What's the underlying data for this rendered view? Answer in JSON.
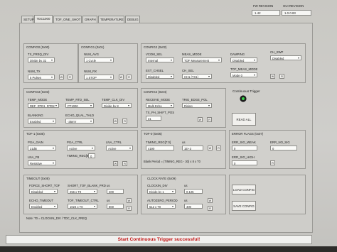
{
  "header": {
    "fw_label": "FW REVISION",
    "gui_label": "GUI REVISION",
    "fw_value": "1.42",
    "gui_value": "1.0.0.83"
  },
  "tabs": [
    {
      "label": "SETUP"
    },
    {
      "label": "TDC1000"
    },
    {
      "label": "TOF_ONE_SHOT"
    },
    {
      "label": "GRAPH"
    },
    {
      "label": "TEMPERATURE"
    },
    {
      "label": "DEBUG"
    }
  ],
  "config0": {
    "title": "CONFIG0 (0x00)",
    "tx_freq_div_label": "TX_FREQ_DIV",
    "tx_freq_div_value": "Divide by 32",
    "num_tx_label": "NUM_TX",
    "num_tx_value": "5 Pulses",
    "btn_w": "W",
    "btn_r": "R"
  },
  "config1": {
    "title": "CONFIG1 (0x01)",
    "num_avg_label": "NUM_AVG",
    "num_avg_value": "1 Cycle",
    "num_rx_label": "NUM_RX",
    "num_rx_value": "1 STOP",
    "btn_w": "W",
    "btn_r": "R"
  },
  "config2": {
    "title": "CONFIG2 (0x02)",
    "vcom_sel_label": "VCOM_SEL",
    "vcom_sel_value": "Internal",
    "meas_mode_label": "MEAS_MODE",
    "meas_mode_value": "TOF Measurement",
    "damping_label": "DAMPING",
    "damping_value": "Disabled",
    "ch_swp_label": "CH_SWP",
    "ch_swp_value": "Disabled",
    "ext_chsel_label": "EXT_CHSEL",
    "ext_chsel_value": "Disabled",
    "ch_sel_label": "CH_SEL",
    "ch_sel_value": "CH1 (TX1)",
    "tof_meas_mode_label": "TOF_MEAS_MODE",
    "tof_meas_mode_value": "Mode 0",
    "btn_w": "W",
    "btn_r": "R"
  },
  "config3": {
    "title": "CONFIG3 (0x03)",
    "temp_mode_label": "TEMP_MODE",
    "temp_mode_value": "REF_RTD1_RTD2",
    "temp_rtd_sel_label": "TEMP_RTD_SEL",
    "temp_rtd_sel_value": "PT1000",
    "temp_clk_div_label": "TEMP_CLK_DIV",
    "temp_clk_div_value": "Divide by 8",
    "blanking_label": "BLANKING",
    "blanking_value": "Enabled",
    "echo_qual_thld_label": "ECHO_QUAL_THLD",
    "echo_qual_thld_value": "-35mV",
    "btn_w": "W",
    "btn_r": "R"
  },
  "config4": {
    "title": "CONFIG4 (0x04)",
    "receive_mode_label": "RECEIVE_MODE",
    "receive_mode_value": "Multi Echo",
    "trig_edge_pol_label": "TRIG_EDGE_POL",
    "trig_edge_pol_value": "Rising",
    "tx_ph_shift_pos_label": "TX_PH_SHIFT_POS",
    "tx_ph_shift_pos_value": "31",
    "btn_w": "W",
    "btn_r": "R"
  },
  "trigger": {
    "title": "Continuous Trigger",
    "read_all_label": "READ ALL"
  },
  "tof1": {
    "title": "TOF-1 (0x05)",
    "pga_gain_label": "PGA_GAIN",
    "pga_gain_value": "21dB",
    "pga_ctrl_label": "PGA_CTRL",
    "pga_ctrl_value": "Active",
    "lna_ctrl_label": "LNA_CTRL",
    "lna_ctrl_value": "Active",
    "timing_reg_label": "TIMING_REG[9:8]",
    "timing_reg_value": "0",
    "lna_fb_label": "LNA_FB",
    "lna_fb_value": "Resistive",
    "btn_w": "W",
    "btn_r": "R"
  },
  "tof0": {
    "title": "TOF-0 (0x06)",
    "timing_reg_label": "TIMING_REG[7:0]",
    "timing_reg_value": "4190",
    "us_unit": "us",
    "us_value": "1E+3",
    "formula": "Blank Period = (TIMING_REG - 30) x 8 x T0",
    "btn_w": "W",
    "btn_r": "R"
  },
  "error_flags": {
    "title": "ERROR FLAGS (0x07)",
    "weak_label": "ERR_SIG_WEAK",
    "weak_value": "0",
    "no_sig_label": "ERR_NO_SIG",
    "no_sig_value": "0",
    "high_label": "ERR_SIG_HIGH",
    "high_value": "0",
    "btn_r": "R"
  },
  "timeout": {
    "title": "TIMEOUT (0x08)",
    "force_short_tof_label": "FORCE_SHORT_TOF",
    "force_short_tof_value": "Disabled",
    "short_tof_blank_period_label": "SHORT_TOF_BLANK_PRD",
    "short_tof_blank_period_value": "256 x T0",
    "us_label_1": "us",
    "us_value_1": "200",
    "echo_timeout_label": "ECHO_TIMEOUT",
    "echo_timeout_value": "Enabled",
    "tof_timeout_ctrl_label": "TOF_TIMEOUT_CTRL",
    "tof_timeout_ctrl_value": "1024 x T0",
    "us_label_2": "us",
    "us_value_2": "800",
    "btn_w": "W",
    "btn_r": "R"
  },
  "clock_rate": {
    "title": "CLOCK RATE (0x09)",
    "clockin_div_label": "CLOCKIN_DIV",
    "clockin_div_value": "Divide by 1",
    "us_label_1": "us",
    "us_value_1": "0.125",
    "autozero_period_label": "AUTOZERO_PERIOD",
    "autozero_period_value": "512 x T0",
    "us_label_2": "us",
    "us_value_2": "400",
    "btn_w": "W",
    "btn_r": "R"
  },
  "config_buttons": {
    "load": "LOAD CONFIG",
    "save": "SAVE CONFIG"
  },
  "footnote": "Note: T0 = CLOCKIN_DIV / TDC_CLK_FREQ",
  "status": "Start Continuous Trigger successful!"
}
